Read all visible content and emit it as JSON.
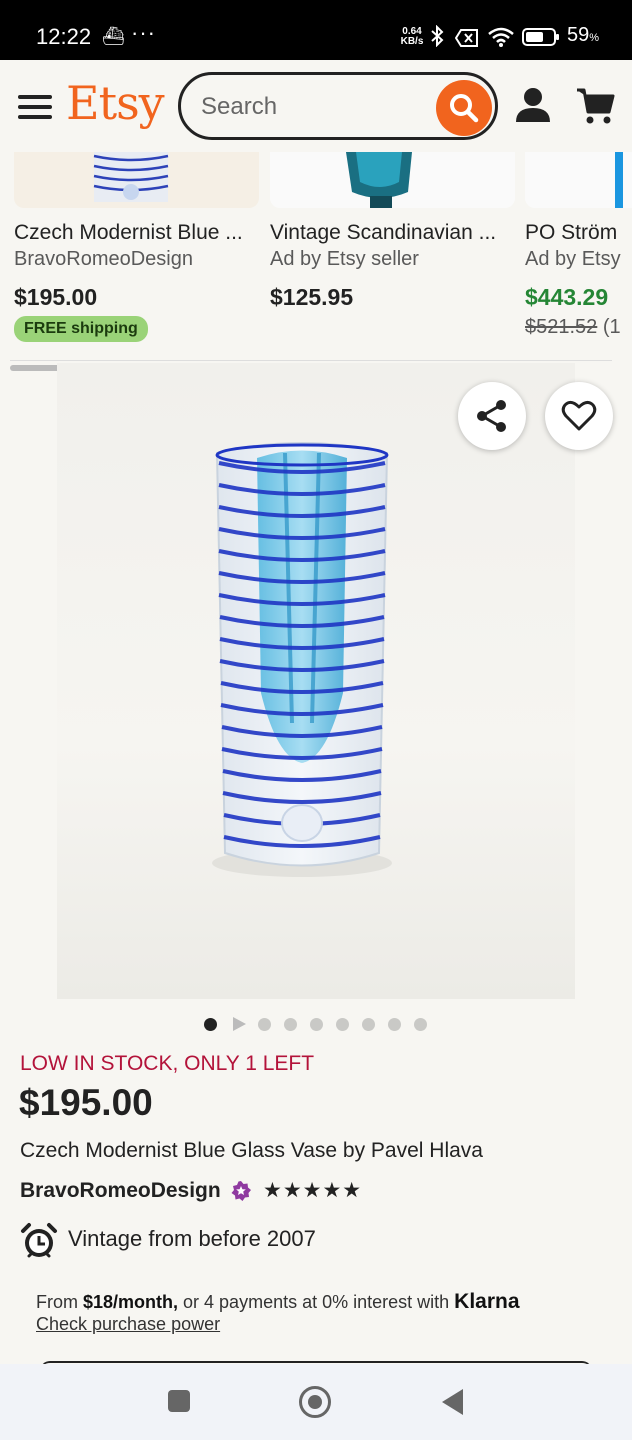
{
  "status_bar": {
    "time": "12:22",
    "overflow": "···",
    "speed_value": "0.64",
    "speed_unit": "KB/s",
    "battery": "59",
    "battery_unit": "%"
  },
  "header": {
    "logo": "Etsy",
    "search_placeholder": "Search",
    "brand_color": "#f1641e"
  },
  "recommendations": [
    {
      "title": "Czech Modernist Blue ...",
      "seller": "BravoRomeoDesign",
      "price": "$195.00",
      "badge": "FREE shipping"
    },
    {
      "title": "Vintage Scandinavian ...",
      "seller": "Ad by Etsy seller",
      "price": "$125.95"
    },
    {
      "title": "PO Ström",
      "seller": "Ad by Etsy",
      "price": "$443.29",
      "original_price": "$521.52",
      "original_suffix": " (1"
    }
  ],
  "carousel": {
    "total_dots": 9,
    "active_index": 0
  },
  "listing": {
    "stock": "LOW IN STOCK, ONLY 1 LEFT",
    "price": "$195.00",
    "title": "Czech Modernist Blue Glass Vase by Pavel Hlava",
    "shop": "BravoRomeoDesign",
    "rating_stars": "★★★★★",
    "vintage": "Vintage from before 2007"
  },
  "klarna": {
    "prefix": "From ",
    "amount": "$18/month,",
    "middle": " or 4 payments at 0% interest with ",
    "brand": "Klarna",
    "link": "Check purchase power"
  }
}
